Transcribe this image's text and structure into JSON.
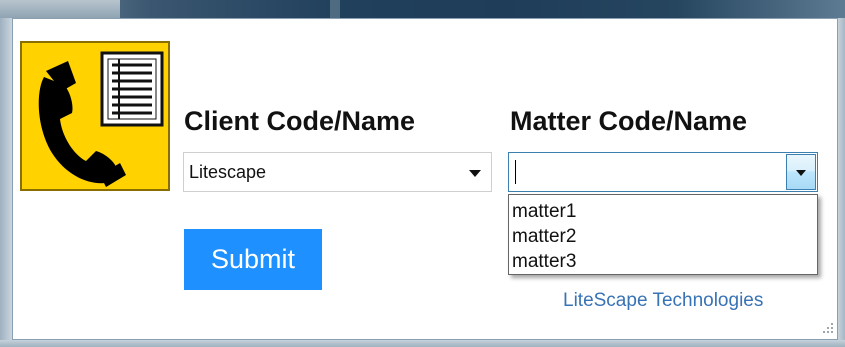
{
  "logo": {
    "icon": "phone-with-notepad-icon",
    "background": "#ffd200"
  },
  "client": {
    "label": "Client Code/Name",
    "value": "Litescape"
  },
  "matter": {
    "label": "Matter Code/Name",
    "value": "",
    "options": [
      "matter1",
      "matter2",
      "matter3"
    ]
  },
  "submit": {
    "label": "Submit",
    "color": "#1e90ff"
  },
  "footer": {
    "company": "LiteScape Technologies"
  }
}
